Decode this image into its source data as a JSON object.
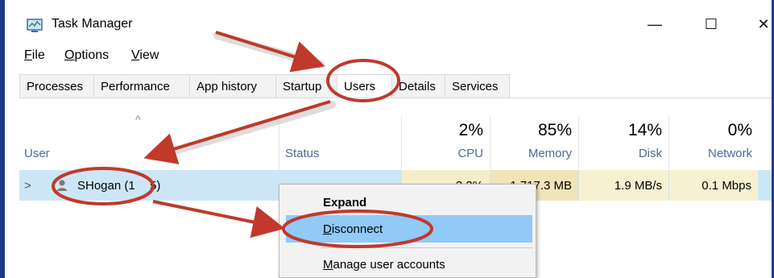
{
  "window": {
    "title": "Task Manager",
    "controls": {
      "minimize": "—",
      "maximize": "☐",
      "close": "✕"
    }
  },
  "menu": {
    "file": {
      "first": "F",
      "rest": "ile"
    },
    "options": {
      "first": "O",
      "rest": "ptions"
    },
    "view": {
      "first": "V",
      "rest": "iew"
    }
  },
  "tabs": [
    "Processes",
    "Performance",
    "App history",
    "Startup",
    "Users",
    "Details",
    "Services"
  ],
  "active_tab": "Users",
  "columns": {
    "user": {
      "label": "User"
    },
    "status": {
      "label": "Status"
    },
    "cpu": {
      "percent": "2%",
      "label": "CPU"
    },
    "memory": {
      "percent": "85%",
      "label": "Memory"
    },
    "disk": {
      "percent": "14%",
      "label": "Disk"
    },
    "network": {
      "percent": "0%",
      "label": "Network"
    }
  },
  "sort_indicator": "^",
  "user_row": {
    "expander": ">",
    "name": "SHogan (1",
    "name_tail": "5)",
    "cpu": "2.2%",
    "memory": "1,717.3 MB",
    "disk": "1.9 MB/s",
    "network": "0.1 Mbps"
  },
  "context_menu": {
    "expand": "Expand",
    "disconnect": {
      "first": "D",
      "rest": "isconnect"
    },
    "manage": {
      "first": "M",
      "rest": "anage user accounts"
    }
  },
  "annotation_color": "#c0392b"
}
